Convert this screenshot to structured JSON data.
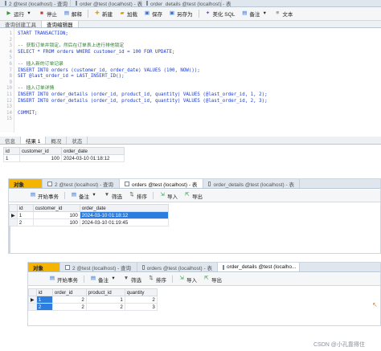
{
  "top": {
    "tabs": [
      {
        "label": "2 @test (localhost) - 查询"
      },
      {
        "label": "order @test (localhost) - 表"
      },
      {
        "label": "order_details @test (localhost) - 表"
      }
    ],
    "toolbar": {
      "run": "运行",
      "stop": "停止",
      "explain": "解释",
      "new": "新建",
      "load": "加载",
      "save": "保存",
      "save_as": "另存为",
      "beautify": "美化 SQL",
      "note": "备注",
      "text": "文本"
    },
    "subtabs": [
      "查询创建工具",
      "查询编辑器"
    ]
  },
  "editor": {
    "line_numbers": [
      "1",
      "2",
      "3",
      "4",
      "5",
      "6",
      "7",
      "8",
      "9",
      "10",
      "11",
      "12",
      "13",
      "14",
      "15"
    ],
    "lines": [
      "START TRANSACTION;",
      "",
      "-- 获取订单并锁定，然后在订单表上进行排他锁定",
      "SELECT * FROM orders WHERE customer_id = 100 FOR UPDATE;",
      "",
      "-- 插入新的订单记录",
      "INSERT INTO orders (customer_id, order_date) VALUES (100, NOW());",
      "SET @last_order_id = LAST_INSERT_ID();",
      "",
      "-- 插入订单详情",
      "INSERT INTO order_details (order_id, product_id, quantity) VALUES (@last_order_id, 1, 2);",
      "INSERT INTO order_details (order_id, product_id, quantity) VALUES (@last_order_id, 2, 3);",
      "",
      "COMMIT;",
      ""
    ]
  },
  "results": {
    "tabs": [
      "信息",
      "结果 1",
      "概况",
      "状态"
    ],
    "columns": [
      "id",
      "customer_id",
      "order_date"
    ],
    "rows": [
      [
        "1",
        "100",
        "2024-03-10 01:18:12"
      ]
    ]
  },
  "panel2": {
    "tabs": [
      "对象",
      "2 @test (localhost) - 查询",
      "orders @test (localhost) - 表",
      "order_details @test (localhost) - 表"
    ],
    "toolbar": {
      "begin_tx": "开始事务",
      "note": "备注",
      "filter": "筛选",
      "sort": "排序",
      "import": "导入",
      "export": "导出"
    },
    "columns": [
      "id",
      "customer_id",
      "order_date"
    ],
    "rows": [
      [
        "1",
        "100",
        "2024-03-10 01:18:12"
      ],
      [
        "2",
        "100",
        "2024-03-10 01:19:45"
      ]
    ]
  },
  "panel3": {
    "tabs": [
      "对象",
      "2 @test (localhost) - 查询",
      "orders @test (localhost) - 表",
      "order_details @test (localho..."
    ],
    "toolbar": {
      "begin_tx": "开始事务",
      "note": "备注",
      "filter": "筛选",
      "sort": "排序",
      "import": "导入",
      "export": "导出"
    },
    "columns": [
      "id",
      "order_id",
      "product_id",
      "quantity"
    ],
    "rows": [
      [
        "1",
        "2",
        "1",
        "2"
      ],
      [
        "2",
        "2",
        "2",
        "3"
      ]
    ]
  },
  "watermark": "CSDN @小孔靠得住"
}
